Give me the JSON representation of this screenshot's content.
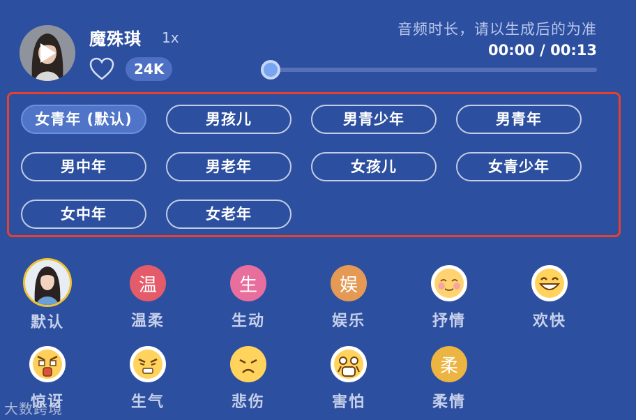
{
  "player": {
    "voice_name": "魔殊琪",
    "speed": "1x",
    "likes": "24K",
    "duration_note": "音频时长，请以生成后的为准",
    "current_time": "00:00",
    "separator": "/",
    "total_time": "00:13",
    "progress": 0.0
  },
  "voice_types": [
    {
      "label": "女青年 (默认)",
      "selected": true
    },
    {
      "label": "男孩儿",
      "selected": false
    },
    {
      "label": "男青少年",
      "selected": false
    },
    {
      "label": "男青年",
      "selected": false
    },
    {
      "label": "男中年",
      "selected": false
    },
    {
      "label": "男老年",
      "selected": false
    },
    {
      "label": "女孩儿",
      "selected": false
    },
    {
      "label": "女青少年",
      "selected": false
    },
    {
      "label": "女中年",
      "selected": false
    },
    {
      "label": "女老年",
      "selected": false
    }
  ],
  "emotions": [
    {
      "label": "默认",
      "icon": "default-avatar-icon",
      "glyph": "",
      "selected": true
    },
    {
      "label": "温柔",
      "icon": "gentle-icon",
      "glyph": "温",
      "color": "#e45b6a"
    },
    {
      "label": "生动",
      "icon": "lively-icon",
      "glyph": "生",
      "color": "#e86e9e"
    },
    {
      "label": "娱乐",
      "icon": "entertainment-icon",
      "glyph": "娱",
      "color": "#e49a55"
    },
    {
      "label": "抒情",
      "icon": "blush-emoji-icon",
      "glyph": ""
    },
    {
      "label": "欢快",
      "icon": "grin-emoji-icon",
      "glyph": ""
    },
    {
      "label": "惊讶",
      "icon": "surprised-emoji-icon",
      "glyph": ""
    },
    {
      "label": "生气",
      "icon": "angry-emoji-icon",
      "glyph": ""
    },
    {
      "label": "悲伤",
      "icon": "sad-emoji-icon",
      "glyph": ""
    },
    {
      "label": "害怕",
      "icon": "scared-emoji-icon",
      "glyph": ""
    },
    {
      "label": "柔情",
      "icon": "tender-icon",
      "glyph": "柔",
      "color": "#ecb440"
    }
  ],
  "watermark": "大数跨境",
  "colors": {
    "background": "#2d4fa0",
    "highlight_border": "#e8402e",
    "selected_pill": "#4f74c8",
    "avatar_ring": "#f0c232"
  }
}
